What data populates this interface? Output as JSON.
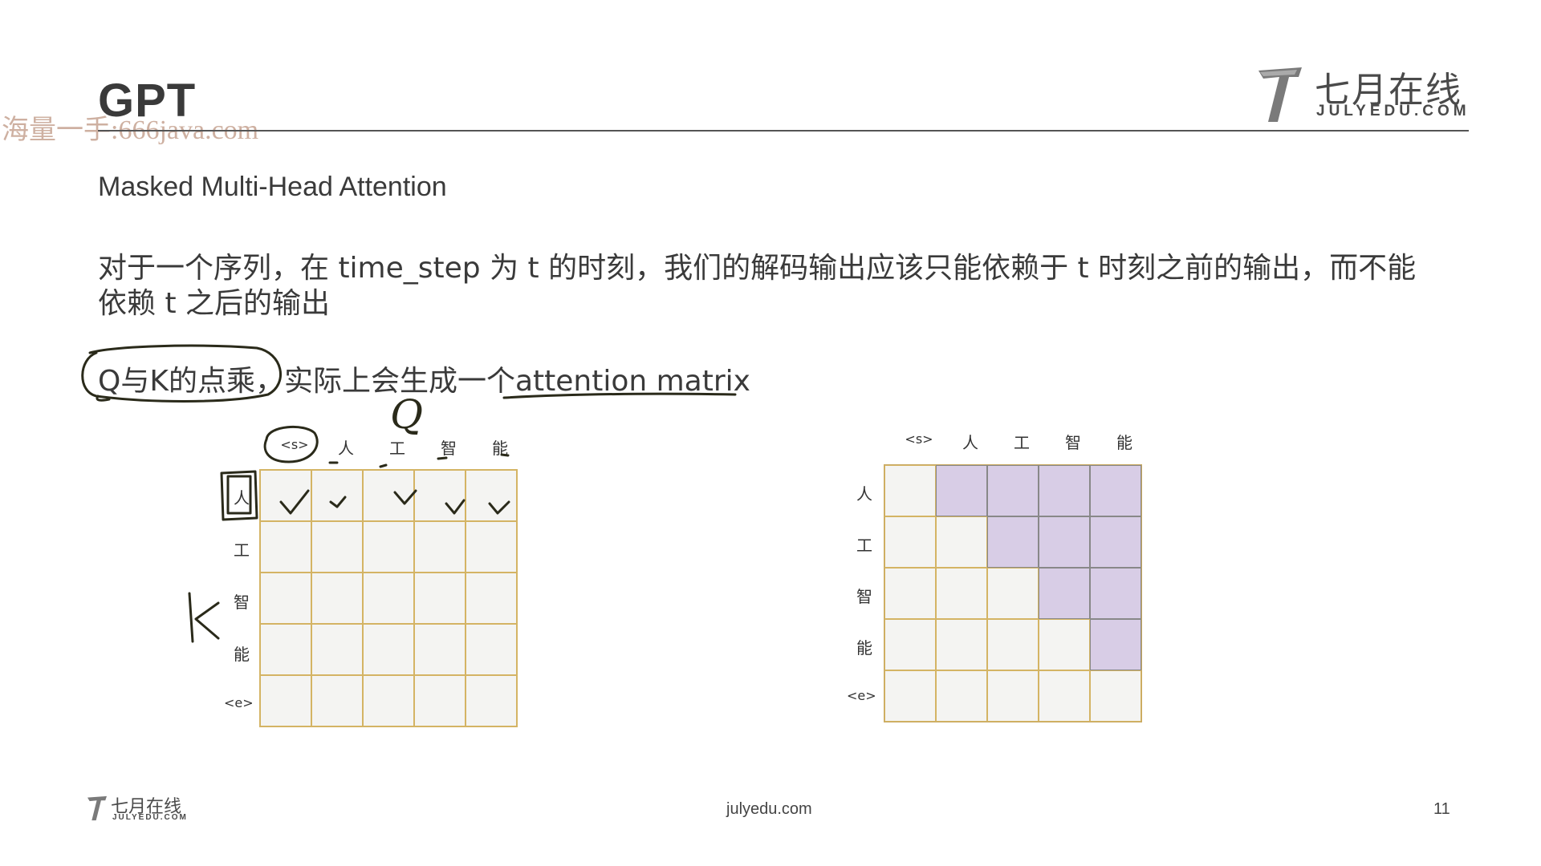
{
  "slide": {
    "title": "GPT",
    "watermark": "海量一手:666java.com",
    "subtitle": "Masked Multi-Head Attention",
    "paragraph": "对于一个序列，在 time_step 为 t 的时刻，我们的解码输出应该只能依赖于 t 时刻之前的输出，而不能依赖 t 之后的输出",
    "paragraph2": "Q与K的点乘，实际上会生成一个attention matrix"
  },
  "logo": {
    "name_cn": "七月在线",
    "name_en": "JULYEDU.COM"
  },
  "left_matrix": {
    "col_labels": [
      "<s>",
      "人",
      "工",
      "智",
      "能"
    ],
    "row_labels": [
      "人",
      "工",
      "智",
      "能",
      "<e>"
    ]
  },
  "right_matrix": {
    "col_labels": [
      "<s>",
      "人",
      "工",
      "智",
      "能"
    ],
    "row_labels": [
      "人",
      "工",
      "智",
      "能",
      "<e>"
    ],
    "masked_cells": [
      [
        0,
        1
      ],
      [
        0,
        2
      ],
      [
        0,
        3
      ],
      [
        0,
        4
      ],
      [
        1,
        2
      ],
      [
        1,
        3
      ],
      [
        1,
        4
      ],
      [
        2,
        3
      ],
      [
        2,
        4
      ],
      [
        3,
        4
      ]
    ]
  },
  "handwriting": {
    "q_mark": "Q",
    "k_mark": "K"
  },
  "footer": {
    "url": "julyedu.com",
    "page_number": "11"
  },
  "colors": {
    "grid_line": "#d4b464",
    "mask_fill": "#d8cde6",
    "ink": "#2a2a1a"
  }
}
